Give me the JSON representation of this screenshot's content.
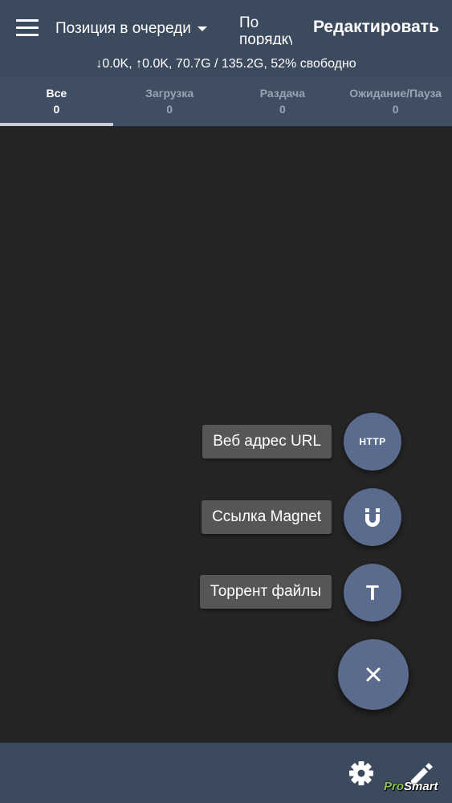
{
  "header": {
    "sort_label": "Позиция в очереди",
    "order_label": "По порядку",
    "edit_label": "Редактировать",
    "status": "↓0.0K, ↑0.0K, 70.7G / 135.2G, 52% свободно"
  },
  "tabs": [
    {
      "label": "Все",
      "count": "0",
      "active": true
    },
    {
      "label": "Загрузка",
      "count": "0",
      "active": false
    },
    {
      "label": "Раздача",
      "count": "0",
      "active": false
    },
    {
      "label": "Ожидание/Пауза",
      "count": "0",
      "active": false
    }
  ],
  "fab_menu": {
    "url": {
      "label": "Веб адрес URL",
      "icon_text": "HTTP",
      "icon": "http-icon"
    },
    "magnet": {
      "label": "Ссылка Magnet",
      "icon": "magnet-icon"
    },
    "torrent": {
      "label": "Торрент файлы",
      "icon_text": "T",
      "icon": "torrent-file-icon"
    },
    "close_icon": "close-icon"
  },
  "bottom_bar": {
    "icons": [
      "settings-icon",
      "pencil-icon"
    ]
  },
  "watermark": {
    "part1": "Pro",
    "part2": "Smart"
  },
  "colors": {
    "background": "#252526",
    "appbar": "#3c4a5e",
    "tabs_bg": "#404e63",
    "fab": "#5a6b8d",
    "label_bg": "#565656"
  }
}
